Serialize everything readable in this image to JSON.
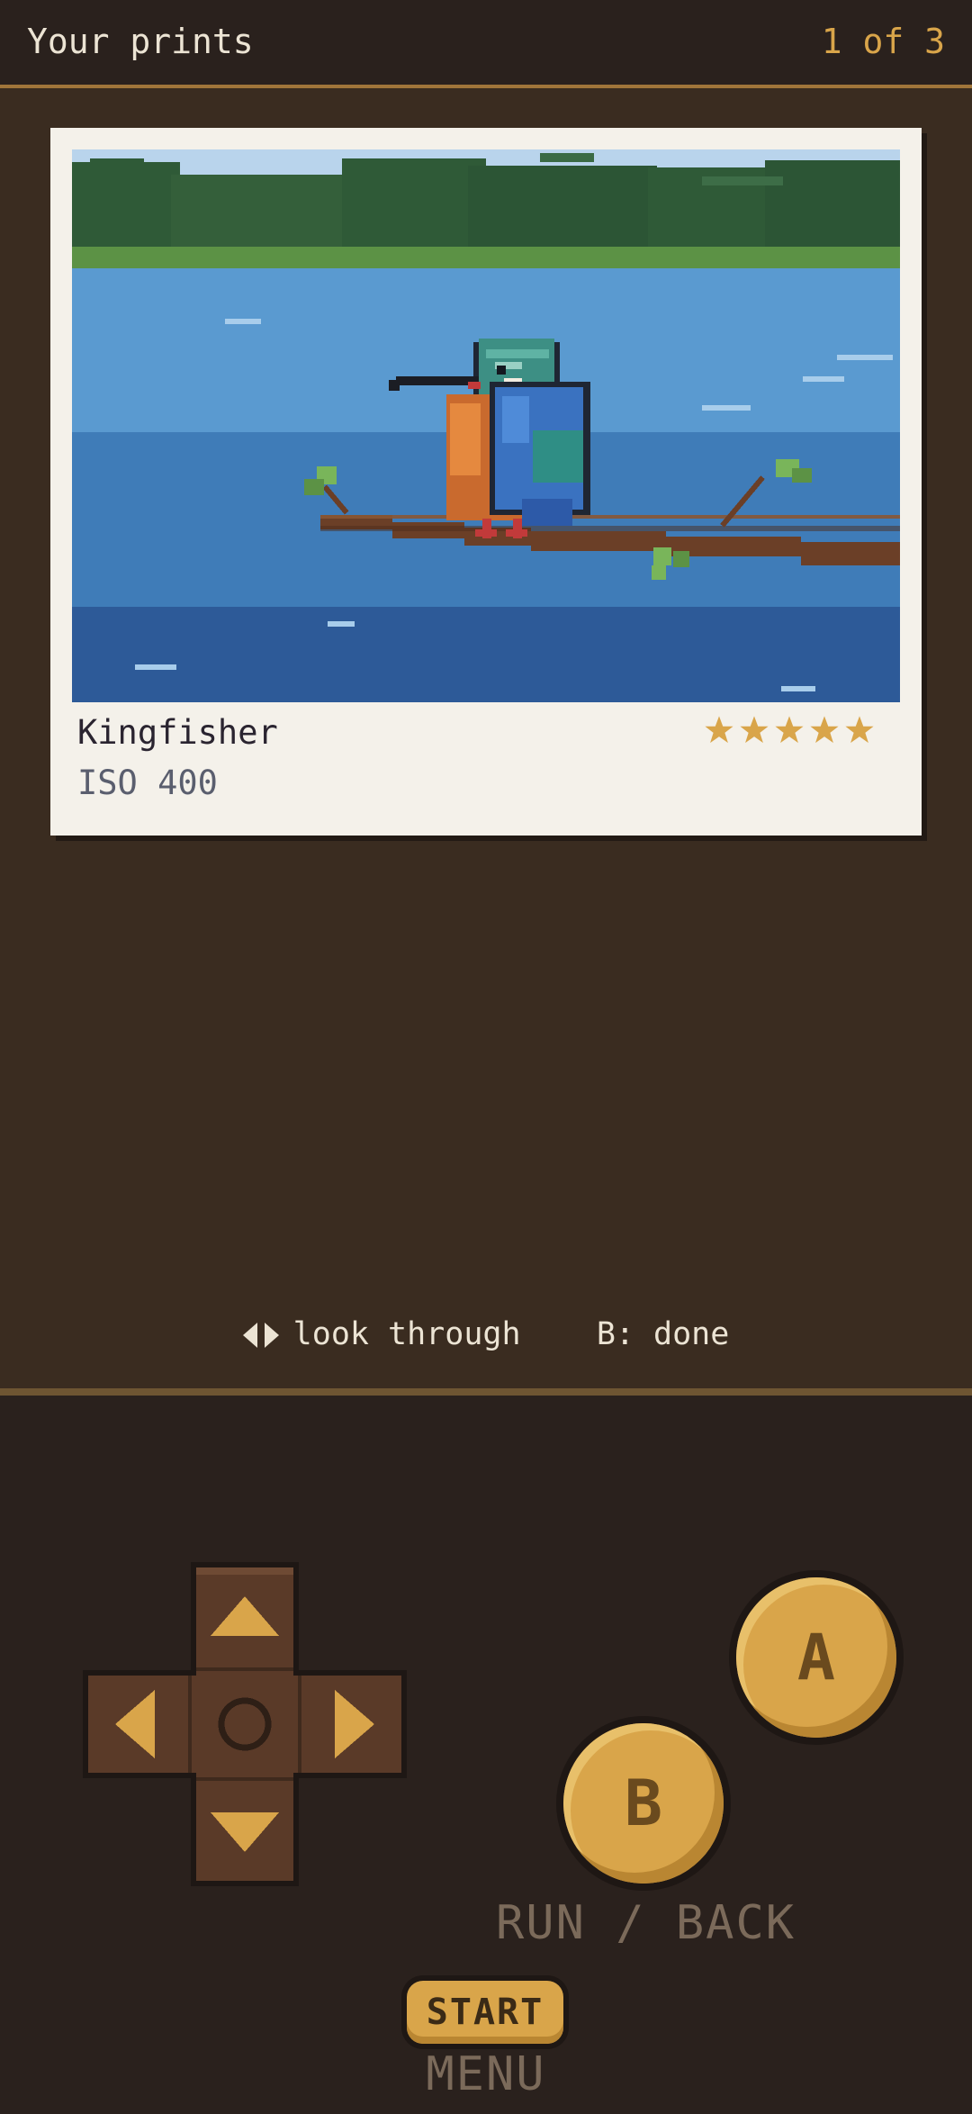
{
  "header": {
    "title": "Your prints",
    "counter": "1 of 3"
  },
  "print": {
    "name": "Kingfisher",
    "iso": "ISO 400",
    "rating": 5,
    "rating_max": 5
  },
  "hint": {
    "text": "look through    B: done"
  },
  "controls": {
    "a_label": "A",
    "b_label": "B",
    "b_caption": "RUN / BACK",
    "start_label": "START",
    "start_caption": "MENU"
  },
  "colors": {
    "accent": "#d9a54a",
    "background": "#3a2c20",
    "panel": "#2a211d"
  }
}
